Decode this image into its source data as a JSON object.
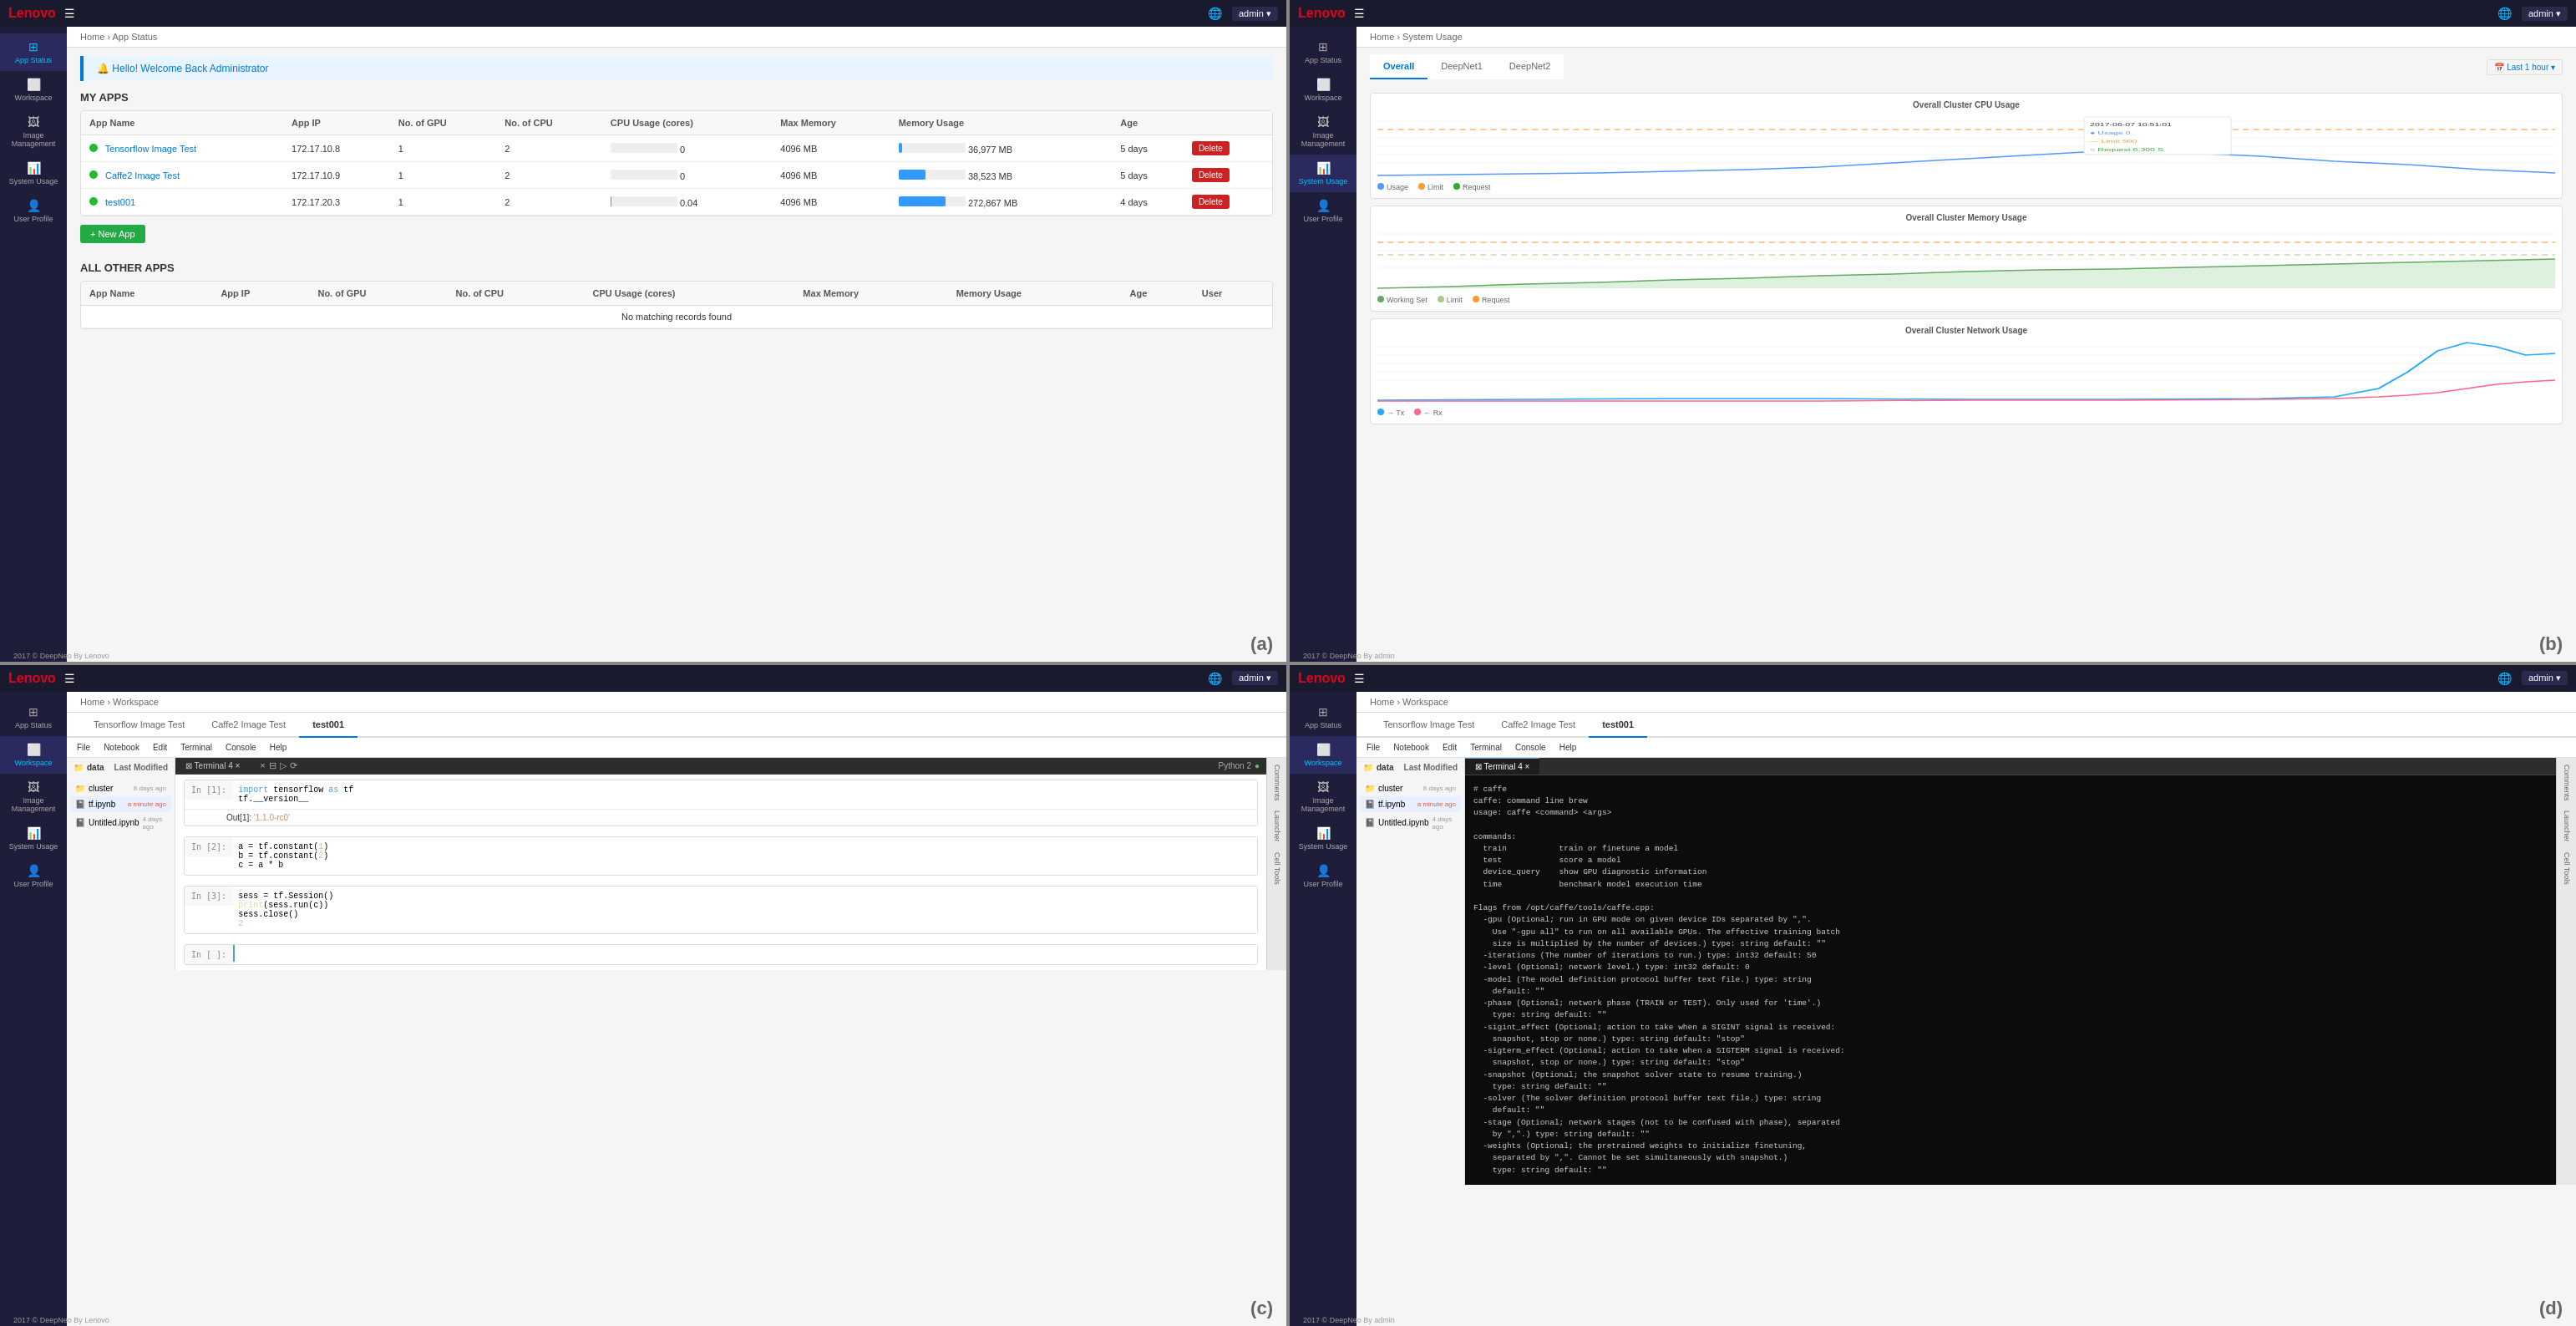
{
  "panels": {
    "a": {
      "label": "(a)",
      "topbar": {
        "logo": "Lenovo",
        "admin": "admin ▾"
      },
      "sidebar": {
        "items": [
          {
            "id": "app-status",
            "icon": "⊞",
            "label": "App Status",
            "active": true
          },
          {
            "id": "workspace",
            "icon": "⬜",
            "label": "Workspace",
            "active": false
          },
          {
            "id": "image-mgmt",
            "icon": "🖼",
            "label": "Image Management",
            "active": false
          },
          {
            "id": "system-usage",
            "icon": "📊",
            "label": "System Usage",
            "active": false
          },
          {
            "id": "user-profile",
            "icon": "👤",
            "label": "User Profile",
            "active": false
          }
        ]
      },
      "breadcrumb": "Home › App Status",
      "welcome": "Hello! Welcome Back Administrator",
      "my_apps_title": "MY APPS",
      "table_headers": [
        "App Name",
        "App IP",
        "No. of GPU",
        "No. of CPU",
        "CPU Usage (cores)",
        "Max Memory",
        "Memory Usage",
        "Age",
        ""
      ],
      "apps": [
        {
          "name": "Tensorflow Image Test",
          "ip": "172.17.10.8",
          "gpu": "1",
          "cpu": "2",
          "cpu_usage": 0,
          "cpu_pct": 0,
          "max_mem": "4096 MB",
          "mem_usage": "36,977 MB",
          "mem_pct": 5,
          "age": "5 days",
          "status": "green"
        },
        {
          "name": "Caffe2 Image Test",
          "ip": "172.17.10.9",
          "gpu": "1",
          "cpu": "2",
          "cpu_usage": 0,
          "cpu_pct": 0,
          "max_mem": "4096 MB",
          "mem_usage": "38,523 MB",
          "mem_pct": 40,
          "age": "5 days",
          "status": "green"
        },
        {
          "name": "test001",
          "ip": "172.17.20.3",
          "gpu": "1",
          "cpu": "2",
          "cpu_usage": 0.04,
          "cpu_pct": 2,
          "max_mem": "4096 MB",
          "mem_usage": "272,867 MB",
          "mem_pct": 70,
          "age": "4 days",
          "status": "green"
        }
      ],
      "new_app_btn": "+ New App",
      "other_apps_title": "ALL OTHER APPS",
      "other_table_headers": [
        "App Name",
        "App IP",
        "No. of GPU",
        "No. of CPU",
        "CPU Usage (cores)",
        "Max Memory",
        "Memory Usage",
        "Age",
        "User"
      ],
      "no_records": "No matching records found",
      "copyright": "2017 © DeepNeo By Lenovo"
    },
    "b": {
      "label": "(b)",
      "topbar": {
        "logo": "Lenovo",
        "admin": "admin ▾"
      },
      "breadcrumb": "Home › System Usage",
      "sidebar_items": [
        "App Status",
        "Workspace",
        "Image Management",
        "System Usage",
        "User Profile"
      ],
      "active_sidebar": "System Usage",
      "tabs": [
        "Overall",
        "DeepNet1",
        "DeepNet2"
      ],
      "active_tab": "Overall",
      "time_filter": "Last 1 hour",
      "charts": [
        {
          "title": "Overall Cluster CPU Usage",
          "type": "line",
          "color": "#5599ff"
        },
        {
          "title": "Overall Cluster Memory Usage",
          "type": "area",
          "color": "#88cc88"
        },
        {
          "title": "Overall Cluster Network Usage",
          "type": "line",
          "color": "#22aaff"
        }
      ],
      "copyright": "2017 © DeepNeo By admin"
    },
    "c": {
      "label": "(c)",
      "topbar": {
        "logo": "Lenovo",
        "admin": "admin ▾"
      },
      "breadcrumb": "Home › Workspace",
      "sidebar_items": [
        "App Status",
        "Workspace",
        "Image Management",
        "System Usage",
        "User Profile"
      ],
      "active_sidebar": "Workspace",
      "tabs": [
        "Tensorflow Image Test",
        "Caffe2 Image Test",
        "test001"
      ],
      "active_tab": "test001",
      "notebook_menus": [
        "File",
        "Notebook",
        "Edit",
        "Terminal",
        "Console",
        "Help"
      ],
      "file_tree": {
        "root": "data",
        "items": [
          {
            "name": "cluster",
            "type": "folder",
            "modified": "8 days ago"
          },
          {
            "name": "tf.ipynb",
            "type": "file",
            "modified": "a minute ago",
            "active": true
          },
          {
            "name": "Untitled.ipynb",
            "type": "file",
            "modified": "4 days ago"
          }
        ]
      },
      "terminal_tab": "Terminal 4",
      "code_cells": [
        {
          "prompt": "In [1]:",
          "code": "import tensorflow as tf\ntf.__version__",
          "output": "Out[1]: '1.1.0-rc0'"
        },
        {
          "prompt": "In [2]:",
          "code": "a = tf.constant(1)\nb = tf.constant(2)\nc = a * b",
          "output": ""
        },
        {
          "prompt": "In [3]:",
          "code": "sess = tf.Session()\nprint(sess.run(c))\nsess.close()\n2",
          "output": ""
        },
        {
          "prompt": "In [ ]:",
          "code": "",
          "output": ""
        }
      ],
      "copyright": "2017 © DeepNeo By Lenovo"
    },
    "d": {
      "label": "(d)",
      "topbar": {
        "logo": "Lenovo",
        "admin": "admin ▾"
      },
      "breadcrumb": "Home › Workspace",
      "sidebar_items": [
        "App Status",
        "Workspace",
        "Image Management",
        "System Usage",
        "User Profile"
      ],
      "active_sidebar": "Workspace",
      "tabs": [
        "Tensorflow Image Test",
        "Caffe2 Image Test",
        "test001"
      ],
      "active_tab": "test001",
      "notebook_menus": [
        "File",
        "Notebook",
        "Edit",
        "Terminal",
        "Console",
        "Help"
      ],
      "terminal_tab": "Terminal 4",
      "file_tree": {
        "root": "data",
        "items": [
          {
            "name": "cluster",
            "type": "folder",
            "modified": "8 days ago"
          },
          {
            "name": "tf.ipynb",
            "type": "file",
            "modified": "a minute ago",
            "active": true
          },
          {
            "name": "Untitled.ipynb",
            "type": "file",
            "modified": "4 days ago"
          }
        ]
      },
      "terminal_content": "# caffe\ncaffe: command line brew\nusage: caffe <command> <args>\n\ncommands:\n  train           train or finetune a model\n  test            score a model\n  device_query    show GPU diagnostic information\n  time            benchmark model execution time\n\nFlags from /opt/caffe/tools/caffe.cpp:\n  -gpu (Optional; run in GPU mode on given device IDs separated by \",\".\n    Use \"-gpu all\" to run on all available GPUs. The effective training batch\n    size is multiplied by the number of devices.) type: string default: \"\"\n  -iterations (The number of iterations to run.) type: int32 default: 50\n  -level (Optional; network level.) type: int32 default: 0\n  -model (The model definition protocol buffer text file.) type: string\n    default: \"\"\n  -phase (Optional; network phase (TRAIN or TEST). Only used for 'time'.)\n    type: string default: \"\"\n  -sigint_effect (Optional; action to take when a SIGINT signal is received:\n    snapshot, stop or none.) type: string default: \"stop\"\n  -sigterm_effect (Optional; action to take when a SIGTERM signal is received:\n    snapshot, stop or none.) type: string default: \"stop\"\n  -snapshot (Optional; the snapshot solver state to resume training.)\n    type: string default: \"\"\n  -solver (The solver definition protocol buffer text file.) type: string\n    default: \"\"\n  -stage (Optional; network stages (not to be confused with phase), separated\n    by \",\".) type: string default: \"\"\n  -weights (Optional; the pretrained weights to initialize finetuning,\n    separated by \",\". Cannot be set simultaneously with snapshot.)\n    type: string default: \"\"",
      "copyright": "2017 © DeepNeo By admin"
    }
  }
}
